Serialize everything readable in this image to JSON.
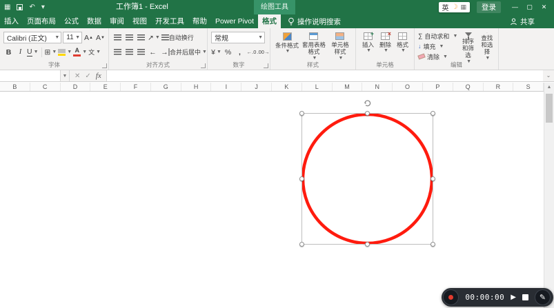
{
  "titlebar": {
    "title": "工作簿1 - Excel",
    "contextual_tab": "绘图工具",
    "sign_in": "登录",
    "ime_lang": "英",
    "window_controls": {
      "minimize": "—",
      "maximize": "▢",
      "close": "✕"
    }
  },
  "tabrow": {
    "tabs": [
      {
        "label": "插入",
        "active": false
      },
      {
        "label": "页面布局",
        "active": false
      },
      {
        "label": "公式",
        "active": false
      },
      {
        "label": "数据",
        "active": false
      },
      {
        "label": "审阅",
        "active": false
      },
      {
        "label": "视图",
        "active": false
      },
      {
        "label": "开发工具",
        "active": false
      },
      {
        "label": "帮助",
        "active": false
      },
      {
        "label": "Power Pivot",
        "active": false
      },
      {
        "label": "格式",
        "active": true
      }
    ],
    "tellme": "操作说明搜索",
    "share": "共享"
  },
  "ribbon": {
    "font": {
      "label": "字体",
      "family": "Calibri (正文)",
      "size": "11",
      "bold": "B",
      "italic": "I",
      "underline": "U",
      "phonetic": "文",
      "grow": "A",
      "shrink": "A",
      "color_letter": "A"
    },
    "alignment": {
      "label": "对齐方式",
      "wrap_text": "自动换行",
      "merge_center": "合并后居中"
    },
    "number": {
      "label": "数字",
      "format": "常规",
      "currency": "¥",
      "percent": "%",
      "comma": ",",
      "inc_decimal": "←.0",
      "dec_decimal": ".00→"
    },
    "styles": {
      "label": "样式",
      "conditional": "条件格式",
      "format_table": "套用表格格式",
      "cell_styles": "单元格样式"
    },
    "cells": {
      "label": "单元格",
      "insert": "插入",
      "delete": "删除",
      "format": "格式"
    },
    "editing": {
      "label": "编辑",
      "autosum": "自动求和",
      "fill": "填充",
      "clear": "清除",
      "sort_filter": "排序和筛选",
      "find_select": "查找和选择",
      "sigma": "∑"
    }
  },
  "formula_bar": {
    "name_box": "",
    "fx": "fx"
  },
  "sheet": {
    "columns": [
      "B",
      "C",
      "D",
      "E",
      "F",
      "G",
      "H",
      "I",
      "J",
      "K",
      "L",
      "M",
      "N",
      "O",
      "P",
      "Q",
      "R",
      "S"
    ]
  },
  "shape": {
    "type": "ellipse",
    "stroke_color": "#FF1B0E"
  },
  "recorder": {
    "time": "00:00:00"
  },
  "colors": {
    "titlebar_green": "#217346",
    "contextual_green": "#379368",
    "ribbon_bg": "#F3F2F1"
  }
}
